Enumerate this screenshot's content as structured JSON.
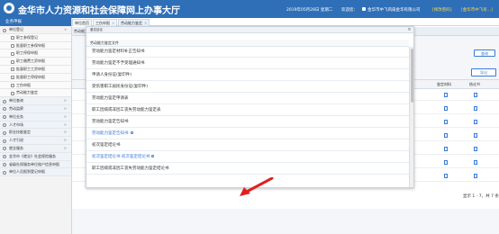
{
  "header": {
    "title": "金华市人力资源和社会保障网上办事大厅",
    "date": "2019年05月28日 星期二",
    "welcome": "欢迎您：",
    "org": "金华市中飞风扇金华有限公司",
    "link1": "[修改密码]",
    "link2": "[金华市中飞有...]"
  },
  "sidebar": {
    "head": "业务申报",
    "items": [
      {
        "label": "单位登记",
        "level": "l1",
        "arrow": "∨"
      },
      {
        "label": "职工参保登记",
        "level": "l2"
      },
      {
        "label": "批量职工参保申报",
        "level": "l2"
      },
      {
        "label": "职工停保申报",
        "level": "l2"
      },
      {
        "label": "职工缴费工资申报",
        "level": "l2"
      },
      {
        "label": "批量职工工资申报",
        "level": "l2"
      },
      {
        "label": "批量职工停保申报",
        "level": "l2"
      },
      {
        "label": "工伤申报",
        "level": "l2"
      },
      {
        "label": "劳动能力鉴定",
        "level": "l2"
      },
      {
        "label": "单位查询",
        "level": "l3",
        "arrow": ">"
      },
      {
        "label": "劳动监察",
        "level": "l3",
        "arrow": ">"
      },
      {
        "label": "单位业务",
        "level": "l3",
        "arrow": ">"
      },
      {
        "label": "人才市场",
        "level": "l3",
        "arrow": ">"
      },
      {
        "label": "职业技能鉴定",
        "level": "l3",
        "arrow": ">"
      },
      {
        "label": "人才引进",
        "level": "l3",
        "arrow": ">"
      },
      {
        "label": "就业服务",
        "level": "l3",
        "arrow": ">"
      },
      {
        "label": "金华市《就业》社会保险服务",
        "level": "l3"
      },
      {
        "label": "省级社保服务单位账户信息申报",
        "level": "l3"
      },
      {
        "label": "单位人员报到登记申报",
        "level": "l3"
      }
    ]
  },
  "tabs": [
    {
      "label": "单位首页"
    },
    {
      "label": "工伤申报"
    },
    {
      "label": "劳动能力鉴定"
    }
  ],
  "content": {
    "panel_head": "劳动能力鉴定",
    "query_btn": "查询",
    "export_btn": "导出",
    "col_a": "鉴定材料",
    "col_b": "结论书",
    "pager": "显示 1 - 7，共 7 条"
  },
  "popup": {
    "bar_title": "鉴定结论",
    "close": "×",
    "subhead": "劳动能力鉴定文件",
    "items": [
      {
        "label": "劳动能力鉴定材料补正告知书",
        "blue": false
      },
      {
        "label": "劳动能力鉴定不予受理通知书",
        "blue": false
      },
      {
        "label": "申请人身份证(复印件)",
        "blue": false
      },
      {
        "label": "受伤害职工居民身份证(复印件)",
        "blue": false
      },
      {
        "label": "劳动能力鉴定申请表",
        "blue": false
      },
      {
        "label": "职工因病或非因工丧失劳动能力鉴定表",
        "blue": false
      },
      {
        "label": "劳动能力鉴定告知书",
        "blue": false
      },
      {
        "label": "劳动能力鉴定告知书",
        "blue": true
      },
      {
        "label": "初次鉴定结论书",
        "blue": false
      },
      {
        "label": "初次鉴定结论书 初次鉴定结论书",
        "blue": true
      },
      {
        "label": "职工因病或非因工丧失劳动能力鉴定结论书",
        "blue": false
      }
    ]
  },
  "colors": {
    "brand": "#2f6fb7",
    "link": "#3a7bd5",
    "arrow": "#e02020"
  }
}
